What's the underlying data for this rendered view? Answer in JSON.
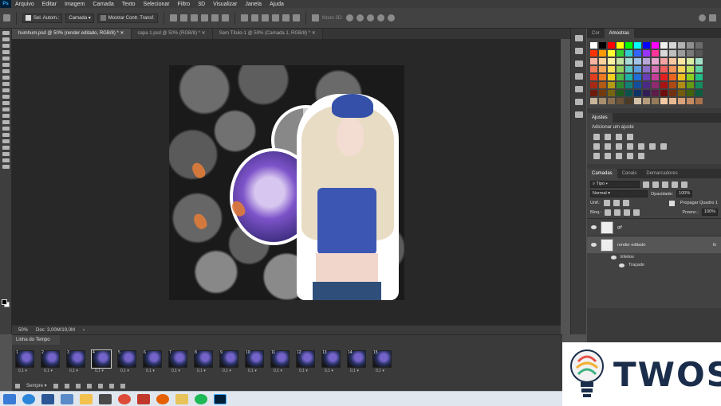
{
  "app": {
    "logo_text": "Ps",
    "menu": [
      "Arquivo",
      "Editar",
      "Imagem",
      "Camada",
      "Texto",
      "Selecionar",
      "Filtro",
      "3D",
      "Visualizar",
      "Janela",
      "Ajuda"
    ]
  },
  "options": {
    "auto_select_label": "Sel. Autom.:",
    "auto_select_value": "Camada",
    "show_transform_label": "Mostrar Contr. Transf.",
    "mode_3d_label": "Modo 3D:"
  },
  "tabs": [
    {
      "label": "humhum.psd @ 50% (render editado, RGB/8) *",
      "active": true
    },
    {
      "label": "capa 1.psd @ 50% (RGB/8) *",
      "active": false
    },
    {
      "label": "Sem Título-1 @ 50% (Camada 1, RGB/8) *",
      "active": false
    }
  ],
  "status": {
    "zoom": "50%",
    "doc": "Doc: 3,00M/19,0M"
  },
  "timeline": {
    "title": "Linha do Tempo",
    "loop": "Sempre",
    "frames": [
      {
        "num": "1",
        "delay": "0,1"
      },
      {
        "num": "2",
        "delay": "0,1"
      },
      {
        "num": "3",
        "delay": "0,1"
      },
      {
        "num": "4",
        "delay": "0,1"
      },
      {
        "num": "5",
        "delay": "0,1"
      },
      {
        "num": "6",
        "delay": "0,1"
      },
      {
        "num": "7",
        "delay": "0,1"
      },
      {
        "num": "8",
        "delay": "0,1"
      },
      {
        "num": "9",
        "delay": "0,1"
      },
      {
        "num": "10",
        "delay": "0,1"
      },
      {
        "num": "11",
        "delay": "0,1"
      },
      {
        "num": "12",
        "delay": "0,1"
      },
      {
        "num": "13",
        "delay": "0,1"
      },
      {
        "num": "14",
        "delay": "0,1"
      },
      {
        "num": "15",
        "delay": "0,1"
      }
    ],
    "selected_frame": "4"
  },
  "panels": {
    "color_tabs": [
      "Cor",
      "Amostras"
    ],
    "adjust_tab": "Ajustes",
    "adjust_label": "Adicionar um ajuste",
    "layer_tabs": [
      "Camadas",
      "Canais",
      "Demarcadores"
    ],
    "kind_filter": "Tipo",
    "blend_mode": "Normal",
    "opacity_label": "Opacidade:",
    "opacity_value": "100%",
    "unify_label": "Unif.:",
    "propagate_label": "Propagar Quadro 1",
    "lock_label": "Bloq.:",
    "fill_label": "Preenc.:",
    "fill_value": "100%",
    "layers": [
      {
        "name": "gif",
        "selected": false
      },
      {
        "name": "render editado",
        "selected": true,
        "fx": "fx"
      }
    ],
    "effects_label": "Efeitos",
    "stroke_label": "Traçado"
  },
  "swatch_colors": [
    "#ffffff",
    "#000000",
    "#ff0000",
    "#ffff00",
    "#00ff00",
    "#00ffff",
    "#0000ff",
    "#ff00ff",
    "#f0f0f0",
    "#d6d6d6",
    "#b3b3b3",
    "#8f8f8f",
    "#6b6b6b",
    "#ff3300",
    "#ff9900",
    "#ffff33",
    "#33cc33",
    "#33cccc",
    "#3366ff",
    "#9933ff",
    "#ff3399",
    "#d9d9d9",
    "#bfbfbf",
    "#9c9c9c",
    "#7a7a7a",
    "#575757",
    "#f7b4a0",
    "#f9d19c",
    "#fdf2a3",
    "#c3e3a2",
    "#a9dcd6",
    "#a3c4e8",
    "#b8a6d9",
    "#e6a8cf",
    "#f5a3a3",
    "#f8c8a3",
    "#fbe7a3",
    "#d9eea3",
    "#a3e0c8",
    "#f07c5c",
    "#f4a65c",
    "#f9e05c",
    "#8fd05c",
    "#5cc7bd",
    "#5c9de0",
    "#8a6fc9",
    "#d66fb3",
    "#ee5c5c",
    "#f2935c",
    "#f7d35c",
    "#b8e05c",
    "#5cd0a3",
    "#e53e1f",
    "#ec7a1f",
    "#f2d01f",
    "#4eb848",
    "#1fb3a6",
    "#1f6fd6",
    "#6a3fb8",
    "#c43f99",
    "#e31f1f",
    "#ea661f",
    "#f0bf1f",
    "#8ccf1f",
    "#1fbf85",
    "#a82a14",
    "#b05a14",
    "#b59a14",
    "#2f8a2f",
    "#147f75",
    "#144e9c",
    "#4a2a85",
    "#8f2a70",
    "#a81414",
    "#ad4a14",
    "#b08c14",
    "#659814",
    "#148c5f",
    "#6e1c0d",
    "#733a0d",
    "#766510",
    "#1f5a1f",
    "#0d534d",
    "#0d3366",
    "#311c57",
    "#5e1c4a",
    "#6e0d0d",
    "#713111",
    "#735c0d",
    "#42630d",
    "#0d5c3e",
    "#c8b59a",
    "#a88f6f",
    "#8a6f4f",
    "#6b5236",
    "#4d3a24",
    "#d4c2a8",
    "#b59c7c",
    "#967a5a",
    "#f3c9a5",
    "#e8b893",
    "#d9a47c",
    "#c48c63",
    "#a8714b"
  ],
  "watermark": {
    "text": "TWOS"
  }
}
